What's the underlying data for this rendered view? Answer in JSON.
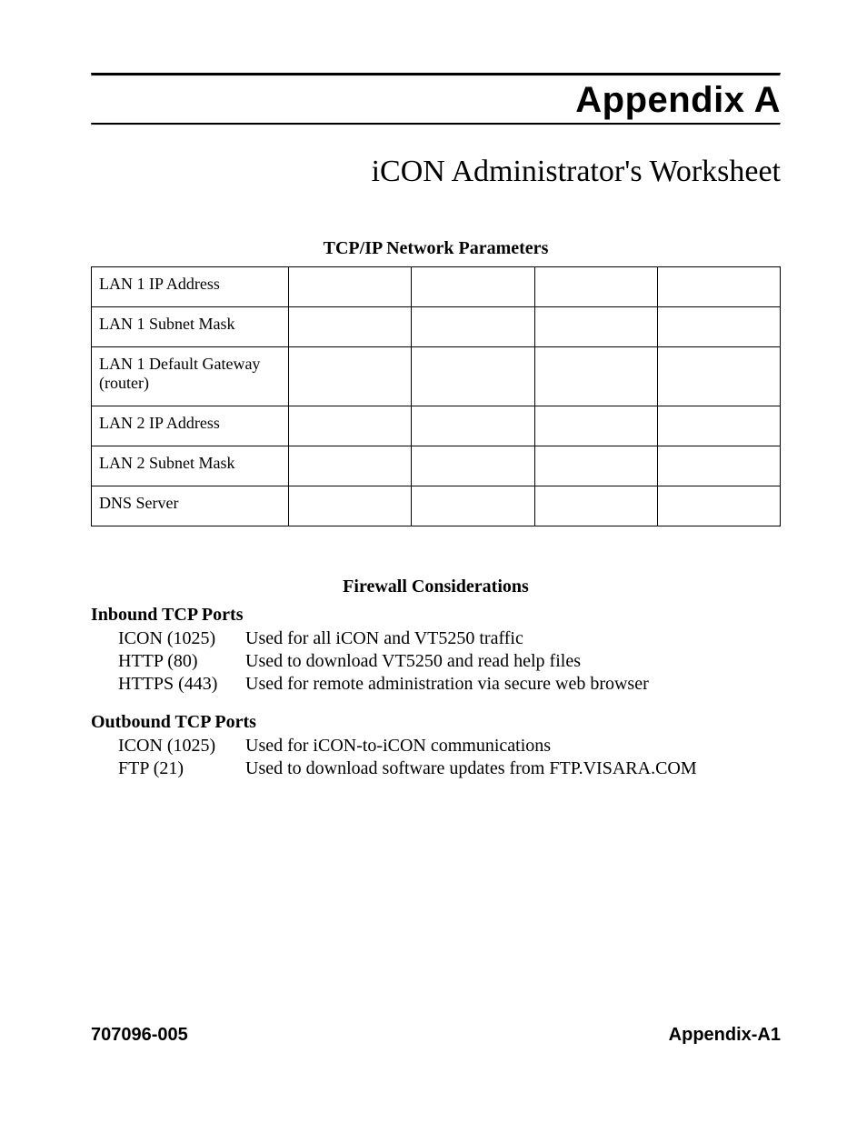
{
  "header": {
    "appendix_label": "Appendix A",
    "doc_title": "iCON Administrator's Worksheet"
  },
  "network": {
    "heading": "TCP/IP Network Parameters",
    "rows": [
      "LAN 1 IP Address",
      "LAN 1 Subnet Mask",
      "LAN 1 Default Gateway (router)",
      "LAN 2 IP Address",
      "LAN 2 Subnet Mask",
      "DNS Server"
    ]
  },
  "firewall": {
    "heading": "Firewall Considerations",
    "inbound_label": "Inbound TCP Ports",
    "inbound": [
      {
        "port": "ICON (1025)",
        "desc": "Used for all iCON and VT5250 traffic"
      },
      {
        "port": "HTTP (80)",
        "desc": "Used to download VT5250 and read help files"
      },
      {
        "port": "HTTPS (443)",
        "desc": "Used for remote administration via secure web browser"
      }
    ],
    "outbound_label": "Outbound TCP Ports",
    "outbound": [
      {
        "port": "ICON (1025)",
        "desc": "Used for iCON-to-iCON communications"
      },
      {
        "port": "FTP (21)",
        "desc": "Used to download software updates from FTP.VISARA.COM"
      }
    ]
  },
  "footer": {
    "left": "707096-005",
    "right": "Appendix-A1"
  }
}
